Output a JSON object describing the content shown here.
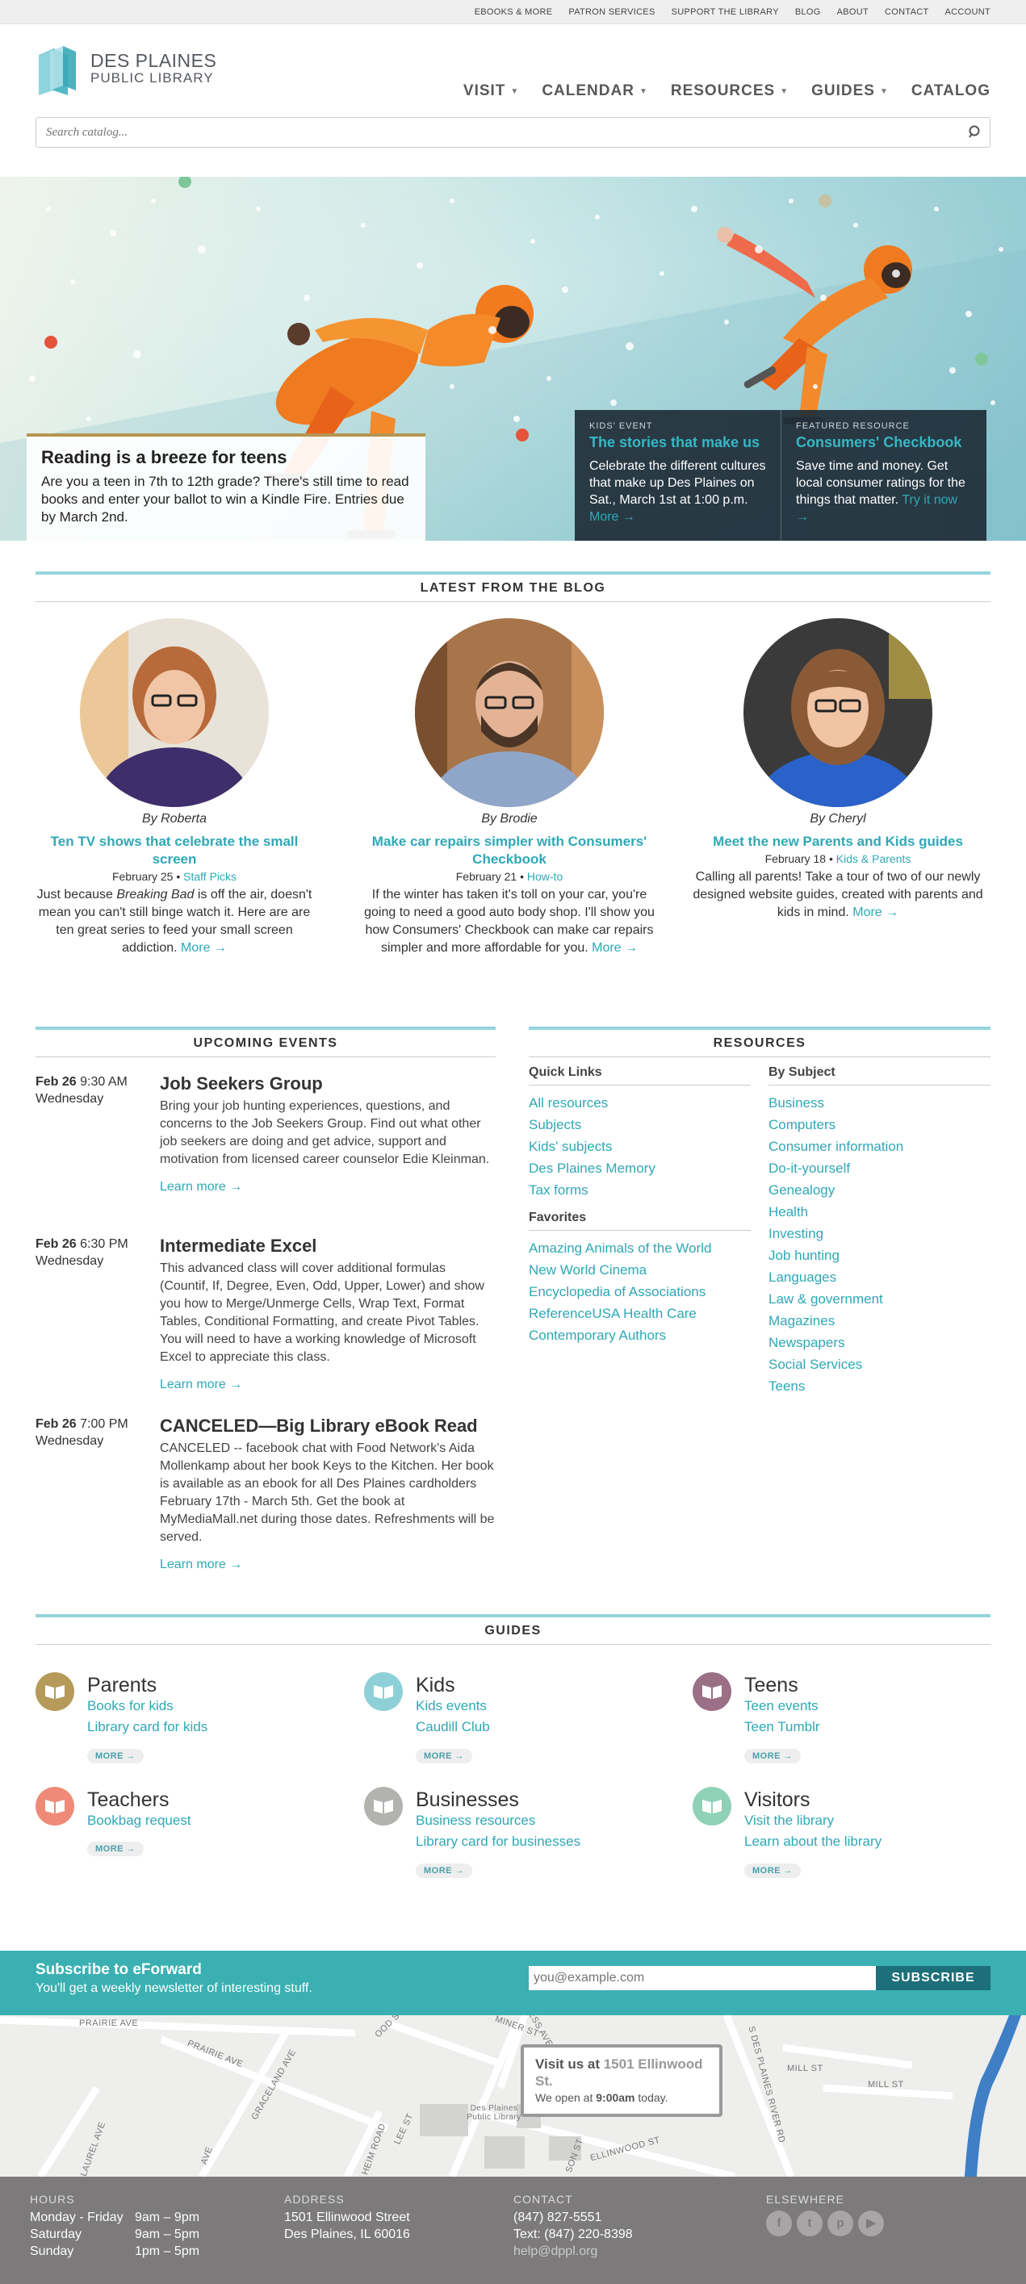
{
  "utility_nav": [
    "EBOOKS & MORE",
    "PATRON SERVICES",
    "SUPPORT THE LIBRARY",
    "BLOG",
    "ABOUT",
    "CONTACT",
    "ACCOUNT"
  ],
  "logo": {
    "line1": "DES PLAINES",
    "line2": "PUBLIC LIBRARY"
  },
  "main_nav": [
    {
      "label": "VISIT",
      "dropdown": true
    },
    {
      "label": "CALENDAR",
      "dropdown": true
    },
    {
      "label": "RESOURCES",
      "dropdown": true
    },
    {
      "label": "GUIDES",
      "dropdown": true
    },
    {
      "label": "CATALOG",
      "dropdown": false
    }
  ],
  "search": {
    "placeholder": "Search catalog..."
  },
  "hero": {
    "title": "Reading is a breeze for teens",
    "text": "Are you a teen in 7th to 12th grade? There's still time to read books and enter your ballot to win a Kindle Fire. Entries due by March 2nd.",
    "promos": [
      {
        "kicker": "KIDS' EVENT",
        "title": "The stories that make us",
        "text": "Celebrate the different cultures that make up Des Plaines on Sat., March 1st at 1:00 p.m.",
        "more": "More →"
      },
      {
        "kicker": "FEATURED RESOURCE",
        "title": "Consumers' Checkbook",
        "text": "Save time and money. Get local consumer ratings for the things that matter.",
        "more": "Try it now →"
      }
    ]
  },
  "blog": {
    "heading": "LATEST FROM THE BLOG",
    "posts": [
      {
        "by": "By Roberta",
        "title": "Ten TV shows that celebrate the small screen",
        "date": "February 25",
        "category": "Staff Picks",
        "excerpt_pre": "Just because ",
        "excerpt_em": "Breaking Bad",
        "excerpt_post": " is off the air, doesn't mean you can't still binge watch it. Here are are ten great series to feed your small screen addiction.",
        "more": "More →",
        "hair": "#b86a3a",
        "shirt": "#3e2e6b",
        "bg": "#e8e2d8"
      },
      {
        "by": "By Brodie",
        "title": "Make car repairs simpler with Consumers' Checkbook",
        "date": "February 21",
        "category": "How-to",
        "excerpt_pre": "If the winter has taken it's toll on your car, you're going to need a good auto body shop. I'll show you how Consumers' Checkbook can make car repairs simpler and more affordable for you.",
        "excerpt_em": "",
        "excerpt_post": "",
        "more": "More →",
        "hair": "#4a3526",
        "shirt": "#8fa6c9",
        "bg": "#a8744a"
      },
      {
        "by": "By Cheryl",
        "title": "Meet the new Parents and Kids guides",
        "date": "February 18",
        "category": "Kids & Parents",
        "excerpt_pre": "Calling all parents! Take a tour of two of our newly designed website guides, created with parents and kids in mind.",
        "excerpt_em": "",
        "excerpt_post": "",
        "more": "More →",
        "hair": "#8a5a36",
        "shirt": "#2a62c9",
        "bg": "#3a3a3a"
      }
    ]
  },
  "events": {
    "heading": "UPCOMING EVENTS",
    "items": [
      {
        "date": "Feb 26",
        "time": "9:30 AM",
        "day": "Wednesday",
        "title": "Job Seekers Group",
        "text": "Bring your job hunting experiences, questions, and concerns to the Job Seekers Group. Find out what other job seekers are doing and get advice, support and motivation from licensed career counselor Edie Kleinman.",
        "more": "Learn more →"
      },
      {
        "date": "Feb 26",
        "time": "6:30 PM",
        "day": "Wednesday",
        "title": "Intermediate Excel",
        "text": "This advanced class will cover additional formulas (Countif, If, Degree, Even, Odd, Upper, Lower) and show you how to Merge/Unmerge Cells, Wrap Text, Format Tables, Conditional Formatting, and create Pivot Tables. You will need to have a working knowledge of Microsoft Excel to appreciate this class.",
        "more": "Learn more →"
      },
      {
        "date": "Feb 26",
        "time": "7:00 PM",
        "day": "Wednesday",
        "title": "CANCELED—Big Library eBook Read",
        "text": "CANCELED -- facebook chat with Food Network's Aida Mollenkamp about her book Keys to the Kitchen. Her book is available as an ebook for all Des Plaines cardholders February 17th - March 5th. Get the book at MyMediaMall.net during those dates. Refreshments will be served.",
        "more": "Learn more →"
      }
    ]
  },
  "resources": {
    "heading": "RESOURCES",
    "quick_links_heading": "Quick Links",
    "quick_links": [
      "All resources",
      "Subjects",
      "Kids' subjects",
      "Des Plaines Memory",
      "Tax forms"
    ],
    "favorites_heading": "Favorites",
    "favorites": [
      "Amazing Animals of the World",
      "New World Cinema",
      "Encyclopedia of Associations",
      "ReferenceUSA Health Care",
      "Contemporary Authors"
    ],
    "by_subject_heading": "By Subject",
    "by_subject": [
      "Business",
      "Computers",
      "Consumer information",
      "Do-it-yourself",
      "Genealogy",
      "Health",
      "Investing",
      "Job hunting",
      "Languages",
      "Law & government",
      "Magazines",
      "Newspapers",
      "Social Services",
      "Teens"
    ]
  },
  "guides": {
    "heading": "GUIDES",
    "items": [
      {
        "title": "Parents",
        "links": [
          "Books for kids",
          "Library card for kids"
        ],
        "more": "MORE →",
        "color": "#b59a5a"
      },
      {
        "title": "Kids",
        "links": [
          "Kids events",
          "Caudill Club"
        ],
        "more": "MORE →",
        "color": "#8ed0d8"
      },
      {
        "title": "Teens",
        "links": [
          "Teen events",
          "Teen Tumblr"
        ],
        "more": "MORE →",
        "color": "#9b6f86"
      },
      {
        "title": "Teachers",
        "links": [
          "Bookbag request"
        ],
        "more": "MORE →",
        "color": "#ef8a79"
      },
      {
        "title": "Businesses",
        "links": [
          "Business resources",
          "Library card for businesses"
        ],
        "more": "MORE →",
        "color": "#b2b2ae"
      },
      {
        "title": "Visitors",
        "links": [
          "Visit the library",
          "Learn about the library"
        ],
        "more": "MORE →",
        "color": "#8fd1b7"
      }
    ]
  },
  "subscribe": {
    "title": "Subscribe to eForward",
    "text": "You'll get a weekly newsletter of interesting stuff.",
    "placeholder": "you@example.com",
    "button": "SUBSCRIBE"
  },
  "map": {
    "popup_prefix": "Visit us at ",
    "popup_address": "1501 Ellinwood St.",
    "popup_hours_pre": "We open at ",
    "popup_hours_time": "9:00am",
    "popup_hours_post": " today.",
    "streets": [
      "PRAIRIE AVE",
      "PRAIRIE AVE",
      "GRACELAND AVE",
      "LAUREL AVE",
      "LEE ST",
      "ELLINWOOD ST",
      "MINER ST",
      "MILL ST",
      "MILL ST",
      "S DES PLAINES RIVER RD",
      "OOD ST",
      "DRESS AVE",
      "HEIM ROAD",
      "SON ST",
      "AVE"
    ],
    "landmark": "Des Plaines Public Library"
  },
  "footer": {
    "hours_heading": "HOURS",
    "hours": [
      [
        "Monday - Friday",
        "9am – 9pm"
      ],
      [
        "Saturday",
        "9am – 5pm"
      ],
      [
        "Sunday",
        "1pm – 5pm"
      ]
    ],
    "address_heading": "ADDRESS",
    "address": [
      "1501 Ellinwood Street",
      "Des Plaines, IL 60016"
    ],
    "contact_heading": "CONTACT",
    "contact": [
      "(847) 827-5551",
      "Text: (847) 220-8398",
      "help@dppl.org"
    ],
    "elsewhere_heading": "ELSEWHERE",
    "social": [
      "facebook-icon",
      "twitter-icon",
      "pinterest-icon",
      "youtube-icon"
    ]
  }
}
